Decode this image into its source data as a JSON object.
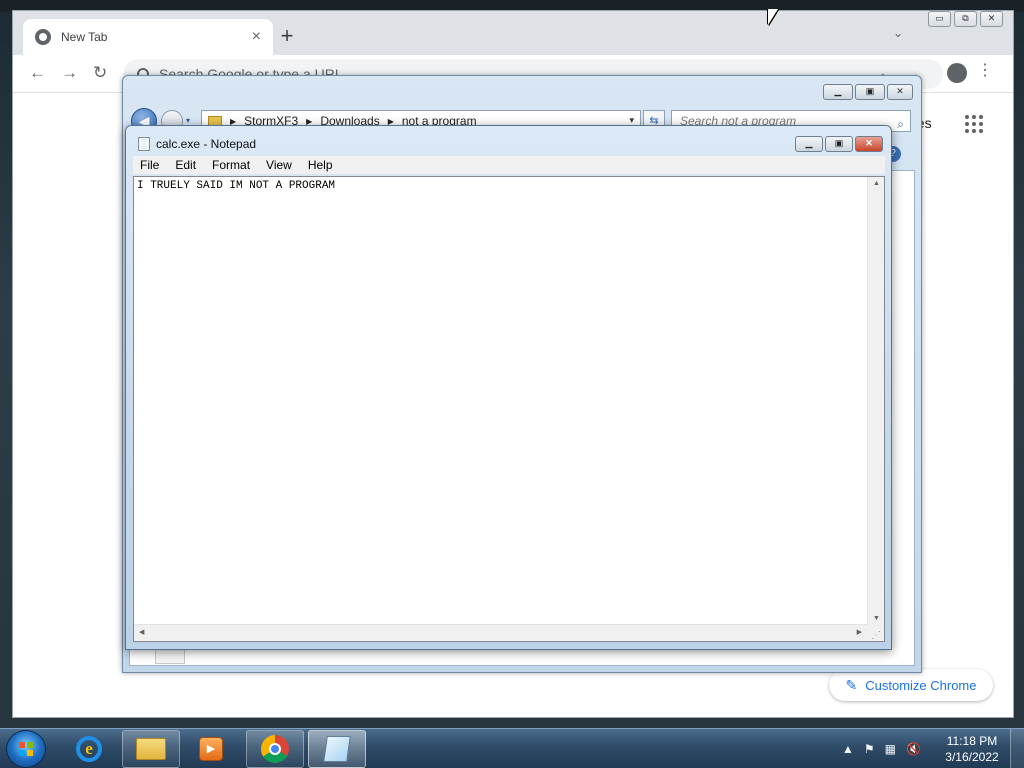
{
  "chrome": {
    "tab_title": "New Tab",
    "tab_close": "×",
    "new_tab": "+",
    "caption": {
      "minimize": "▭",
      "maximize": "⧉",
      "close": "✕"
    },
    "tab_search": "⌄",
    "back": "←",
    "forward": "→",
    "reload": "↻",
    "omnibox_placeholder": "Search Google or type a URL",
    "share_icon": "⇪",
    "star_icon": "☆",
    "kebab": "⋮",
    "images_link": "ges",
    "customize_label": "Customize Chrome",
    "pencil_icon": "✎"
  },
  "explorer": {
    "breadcrumbs": [
      "StormXF3",
      "Downloads",
      "not a program"
    ],
    "search_placeholder": "Search not a program",
    "search_icon": "⌕",
    "refresh": "⇆",
    "back": "◀",
    "dropdown": "▾",
    "help_icon": "?",
    "caption": {
      "minimize": "▁",
      "maximize": "▣",
      "close": "✕"
    }
  },
  "notepad": {
    "title": "calc.exe - Notepad",
    "menu": [
      "File",
      "Edit",
      "Format",
      "View",
      "Help"
    ],
    "content": "I TRUELY SAID IM NOT A PROGRAM",
    "caption": {
      "minimize": "▁",
      "maximize": "▣",
      "close": "✕"
    },
    "scroll": {
      "up": "▲",
      "down": "▼",
      "left": "◀",
      "right": "▶"
    }
  },
  "taskbar": {
    "media_glyph": "▶",
    "ie_glyph": "e",
    "tray": {
      "show_hidden": "▲",
      "flag": "⚑",
      "network": "▦",
      "volume": "🔇"
    },
    "clock_time": "11:18 PM",
    "clock_date": "3/16/2022"
  },
  "colors": {
    "accent": "#1a73e8",
    "taskbar": "#2e4b68",
    "close_button": "#c9442d"
  }
}
